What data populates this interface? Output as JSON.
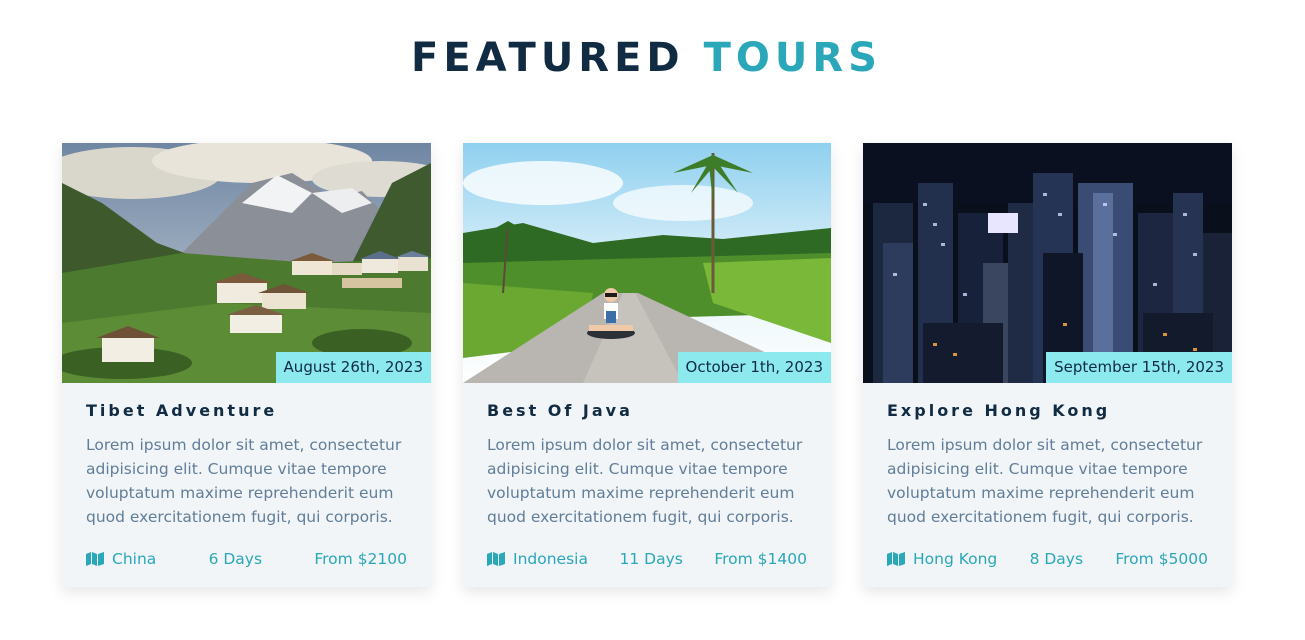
{
  "section": {
    "title_part1": "FEATURED",
    "title_part2": "TOURS"
  },
  "colors": {
    "heading_dark": "#112b43",
    "accent": "#2aa7b9",
    "date_badge": "#8ce9ee",
    "card_bg": "#f1f5f8",
    "body_text": "#617d98"
  },
  "tours": [
    {
      "image_icon": "mountain-village-photo",
      "date": "August 26th, 2023",
      "title": "Tibet Adventure",
      "text": "Lorem ipsum dolor sit amet, consectetur adipisicing elit. Cumque vitae tempore voluptatum maxime reprehenderit eum quod exercitationem fugit, qui corporis.",
      "location_icon": "map-icon",
      "location": "China",
      "duration": "6 Days",
      "price": "From $2100"
    },
    {
      "image_icon": "tropical-road-photo",
      "date": "October 1th, 2023",
      "title": "Best Of Java",
      "text": "Lorem ipsum dolor sit amet, consectetur adipisicing elit. Cumque vitae tempore voluptatum maxime reprehenderit eum quod exercitationem fugit, qui corporis.",
      "location_icon": "map-icon",
      "location": "Indonesia",
      "duration": "11 Days",
      "price": "From $1400"
    },
    {
      "image_icon": "city-night-photo",
      "date": "September 15th, 2023",
      "title": "Explore Hong Kong",
      "text": "Lorem ipsum dolor sit amet, consectetur adipisicing elit. Cumque vitae tempore voluptatum maxime reprehenderit eum quod exercitationem fugit, qui corporis.",
      "location_icon": "map-icon",
      "location": "Hong Kong",
      "duration": "8 Days",
      "price": "From $5000"
    }
  ]
}
